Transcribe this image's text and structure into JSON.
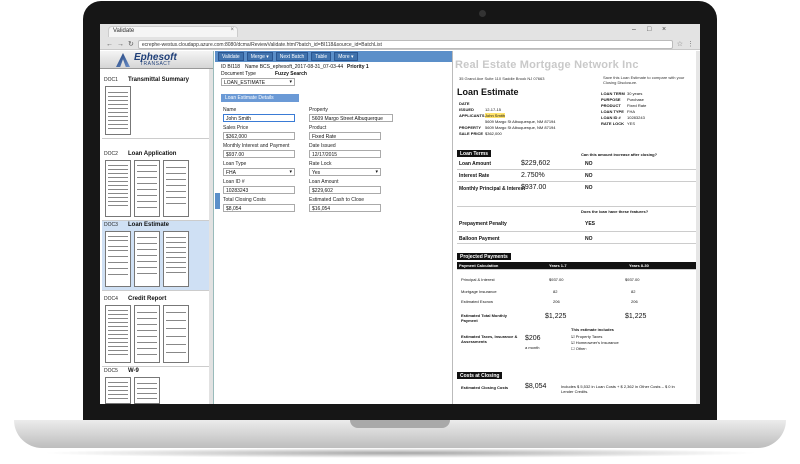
{
  "browser": {
    "tab_title": "Validate",
    "url": "ecrephe-westus.cloudapp.azure.com:8080/dcma/ReviewValidate.html?batch_id=BI118&source_id=BatchList"
  },
  "app": {
    "logo_name": "Ephesoft",
    "logo_sub": "TRANSACT",
    "toolbar": [
      "Validate",
      "Merge ▾",
      "Next Batch",
      "Table",
      "More ▾"
    ],
    "batch_id": "ID BI118",
    "batch_name": "Name BCS_ephesoft_2017-08-31_07-03-44",
    "priority": "Priority 1",
    "document_type_label": "Document Type",
    "fuzzy_search_label": "Fuzzy Search",
    "document_type_value": "LOAN_ESTIMATE",
    "section_title": "Loan Estimate Details"
  },
  "documents": [
    {
      "id": "DOC1",
      "title": "Transmittal Summary"
    },
    {
      "id": "DOC2",
      "title": "Loan Application"
    },
    {
      "id": "DOC3",
      "title": "Loan Estimate"
    },
    {
      "id": "DOC4",
      "title": "Credit Report"
    },
    {
      "id": "DOC5",
      "title": "W-9"
    }
  ],
  "fields": {
    "name_label": "Name",
    "name_value": "John Smith",
    "property_label": "Property",
    "property_value": "5609 Margo Street Albuquerque",
    "sales_price_label": "Sales Price",
    "sales_price_value": "$362,000",
    "product_label": "Product",
    "product_value": "Fixed Rate",
    "mi_label": "Monthly Interest and Payment",
    "mi_value": "$937.00",
    "date_issued_label": "Date Issued",
    "date_issued_value": "12/17/2015",
    "loan_type_label": "Loan Type",
    "loan_type_value": "FHA",
    "rate_lock_label": "Rate Lock",
    "rate_lock_value": "Yes",
    "loan_id_label": "Loan ID #",
    "loan_id_value": "10283243",
    "loan_amount_label": "Loan Amount",
    "loan_amount_value": "$229,602",
    "closing_costs_label": "Total Closing Costs",
    "closing_costs_value": "$8,054",
    "cash_label": "Estimated Cash to Close",
    "cash_value": "$16,054"
  },
  "document": {
    "header": "Real Estate Mortgage Network Inc",
    "address": "35 Grand Ave Suite 110 Saddle Brook NJ 07663",
    "title": "Loan Estimate",
    "save_text": "Save this Loan Estimate to compare with your Closing Disclosure.",
    "date_issued_label": "DATE ISSUED",
    "date_issued": "12-17-15",
    "applicants_label": "APPLICANTS",
    "applicants": "John Smith",
    "applicant_address": "5609 Margo St Albuquerque, NM 87194",
    "property_label": "PROPERTY",
    "property": "5609 Margo St Albuquerque, NM 87194",
    "sale_price_label": "SALE PRICE",
    "sale_price": "$362,000",
    "loan_term_label": "LOAN TERM",
    "loan_term": "30 years",
    "purpose_label": "PURPOSE",
    "purpose": "Purchase",
    "product_label": "PRODUCT",
    "product": "Fixed Rate",
    "loan_type_label": "LOAN TYPE",
    "loan_type": "FHA",
    "loan_id_label": "LOAN ID #",
    "loan_id": "10283243",
    "rate_lock_label": "RATE LOCK",
    "rate_lock": "YES",
    "loan_terms_bar": "Loan Terms",
    "question": "Can this amount increase after closing?",
    "terms": [
      {
        "label": "Loan Amount",
        "value": "$229,602",
        "answer": "NO"
      },
      {
        "label": "Interest Rate",
        "value": "2.750%",
        "answer": "NO"
      },
      {
        "label": "Monthly Principal & Interest",
        "value": "$937.00",
        "answer": "NO"
      },
      {
        "label": "Prepayment Penalty",
        "value": "",
        "answer": "YES"
      },
      {
        "label": "Balloon Payment",
        "value": "",
        "answer": "NO"
      }
    ],
    "features_q": "Does the loan have these features?",
    "projected_bar": "Projected Payments",
    "payment_calc": "Payment Calculation",
    "years_1_7": "Years 1-7",
    "years_8_30": "Years 8-30",
    "pi_label": "Principal & Interest",
    "pi_1": "$937.00",
    "pi_2": "$937.00",
    "mi_label": "Mortgage Insurance",
    "mi_1": "82",
    "mi_2": "82",
    "escrow_label": "Estimated Escrow",
    "escrow_1": "206",
    "escrow_2": "206",
    "total_label": "Estimated Total Monthly Payment",
    "total_1": "$1,225",
    "total_2": "$1,225",
    "taxes_label": "Estimated Taxes, Insurance & Assessments",
    "taxes_value": "$206",
    "taxes_freq": "a month",
    "estimate_includes": "This estimate includes",
    "includes": [
      "Property Taxes",
      "Homeowner's Insurance",
      "Other:"
    ],
    "costs_bar": "Costs at Closing",
    "est_closing_label": "Estimated Closing Costs",
    "est_closing_value": "$8,054",
    "closing_note": "Includes $ 5,532 in Loan Costs + $ 2,362 in Other Costs – $ 0 in Lender Credits."
  }
}
